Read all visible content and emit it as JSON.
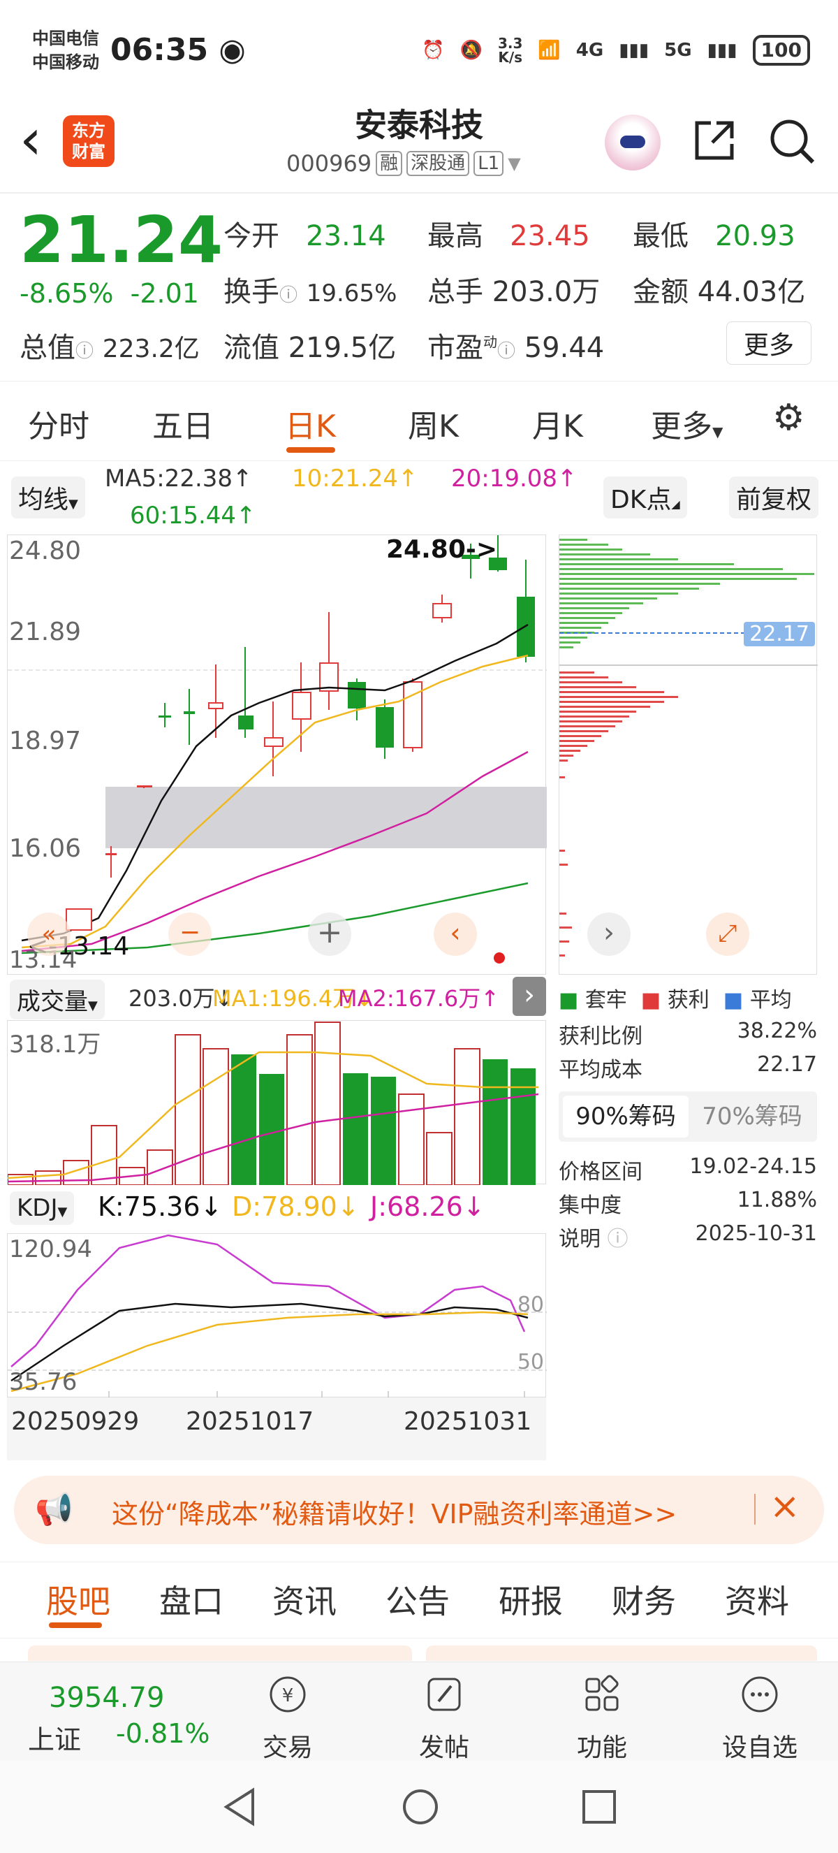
{
  "status_bar": {
    "carrier1": "中国电信",
    "carrier2": "中国移动",
    "time": "06:35",
    "net_speed_value": "3.3",
    "net_speed_unit": "K/s",
    "net1": "4G",
    "net2": "5G",
    "battery": "100"
  },
  "header": {
    "name": "安泰科技",
    "code": "000969",
    "tags": [
      "融",
      "深股通",
      "L1"
    ],
    "logo_line1": "东方",
    "logo_line2": "财富"
  },
  "quote": {
    "price": "21.24",
    "change_pct": "-8.65%",
    "change": "-2.01",
    "open_label": "今开",
    "open": "23.14",
    "high_label": "最高",
    "high": "23.45",
    "low_label": "最低",
    "low": "20.93",
    "turnover_label": "换手",
    "turnover": "19.65%",
    "volume_label": "总手",
    "volume": "203.0万",
    "amount_label": "金额",
    "amount": "44.03亿",
    "mktcap_label": "总值",
    "mktcap": "223.2亿",
    "float_label": "流值",
    "float_cap": "219.5亿",
    "pe_label": "市盈",
    "pe_sup": "动",
    "pe": "59.44",
    "more": "更多"
  },
  "chart_tabs": [
    "分时",
    "五日",
    "日K",
    "周K",
    "月K",
    "更多"
  ],
  "ma_bar": {
    "selector": "均线",
    "ma5": "MA5:22.38↑",
    "ma10": "10:21.24↑",
    "ma20": "20:19.08↑",
    "ma60": "60:15.44↑",
    "dk": "DK点",
    "adjust": "前复权"
  },
  "main_chart": {
    "y_labels": [
      "24.80",
      "21.89",
      "18.97",
      "16.06",
      "13.14"
    ],
    "high_marker": "24.80->",
    "low_marker": "<-13.14",
    "chip_avg": "22.17"
  },
  "volume": {
    "selector": "成交量",
    "vol": "203.0万↓",
    "ma1": "MA1:196.4万↓",
    "ma2": "MA2:167.6万↑",
    "y_max": "318.1万"
  },
  "kdj": {
    "selector": "KDJ",
    "k": "K:75.36↓",
    "d": "D:78.90↓",
    "j": "J:68.26↓",
    "y_max": "120.94",
    "y_min": "35.76",
    "l80": "80",
    "l50": "50",
    "dates": [
      "20250929",
      "20251017",
      "20251031"
    ]
  },
  "chip": {
    "legend": [
      "套牢",
      "获利",
      "平均"
    ],
    "rows": [
      {
        "label": "获利比例",
        "value": "38.22%"
      },
      {
        "label": "平均成本",
        "value": "22.17"
      }
    ],
    "tab90": "90%筹码",
    "tab70": "70%筹码",
    "rows2": [
      {
        "label": "价格区间",
        "value": "19.02-24.15"
      },
      {
        "label": "集中度",
        "value": "11.88%"
      },
      {
        "label": "说明",
        "value": "2025-10-31"
      }
    ]
  },
  "banner": {
    "text": "这份“降成本”秘籍请收好！VIP融资利率通道>>"
  },
  "bottom_tabs": [
    "股吧",
    "盘口",
    "资讯",
    "公告",
    "研报",
    "财务",
    "资料"
  ],
  "footer": {
    "index_value": "3954.79",
    "index_name": "上证",
    "index_change": "-0.81%",
    "items": [
      "交易",
      "发帖",
      "功能",
      "设自选"
    ]
  },
  "colors": {
    "up": "#e03a3a",
    "down": "#1a9a2a",
    "accent": "#e25a12"
  }
}
